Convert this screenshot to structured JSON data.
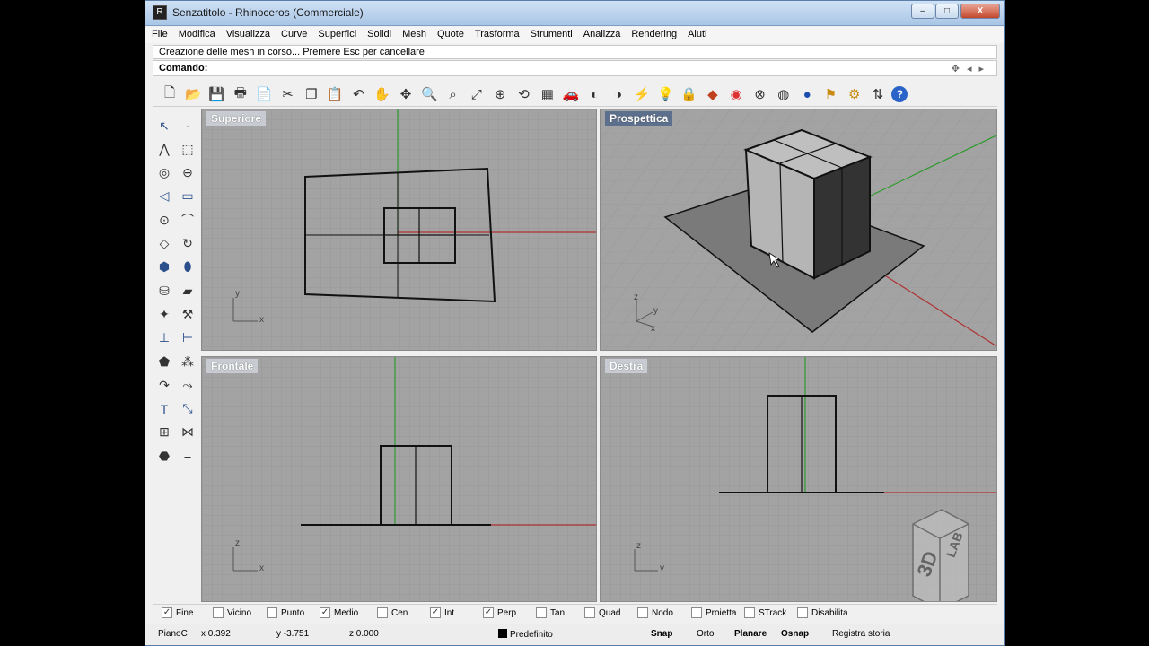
{
  "window": {
    "title": "Senzatitolo - Rhinoceros (Commerciale)",
    "controls": {
      "minimize": "–",
      "maximize": "□",
      "close": "X"
    }
  },
  "menu": [
    "File",
    "Modifica",
    "Visualizza",
    "Curve",
    "Superfici",
    "Solidi",
    "Mesh",
    "Quote",
    "Trasforma",
    "Strumenti",
    "Analizza",
    "Rendering",
    "Aiuti"
  ],
  "command": {
    "history": "Creazione delle mesh in corso... Premere Esc per cancellare",
    "prompt": "Comando:"
  },
  "toolbar_icons": [
    "new-icon",
    "open-icon",
    "save-icon",
    "print-icon",
    "import-icon",
    "cut-icon",
    "copy-icon",
    "paste-icon",
    "undo-icon",
    "pan-hand-icon",
    "move-view-icon",
    "zoom-icon",
    "zoom-window-icon",
    "zoom-extents-icon",
    "zoom-selected-icon",
    "rotate-view-icon",
    "four-viewports-icon",
    "car-icon",
    "hide-icon",
    "show-icon",
    "snap-icon",
    "light-icon",
    "lock-icon",
    "layer-icon",
    "color-wheel-icon",
    "sphere-wire-icon",
    "sphere-shaded-icon",
    "sphere-render-icon",
    "flag-icon",
    "gear-icon",
    "options-icon",
    "help-icon"
  ],
  "viewports": {
    "top": {
      "label": "Superiore",
      "axes": [
        "y",
        "x"
      ]
    },
    "perspective": {
      "label": "Prospettica",
      "axes": [
        "z",
        "y",
        "x"
      ]
    },
    "front": {
      "label": "Frontale",
      "axes": [
        "z",
        "x"
      ]
    },
    "right": {
      "label": "Destra",
      "axes": [
        "z",
        "y"
      ]
    }
  },
  "osnaps": [
    {
      "label": "Fine",
      "checked": true
    },
    {
      "label": "Vicino",
      "checked": false
    },
    {
      "label": "Punto",
      "checked": false
    },
    {
      "label": "Medio",
      "checked": true
    },
    {
      "label": "Cen",
      "checked": false
    },
    {
      "label": "Int",
      "checked": true
    },
    {
      "label": "Perp",
      "checked": true
    },
    {
      "label": "Tan",
      "checked": false
    },
    {
      "label": "Quad",
      "checked": false
    },
    {
      "label": "Nodo",
      "checked": false
    },
    {
      "label": "Proietta",
      "checked": false
    },
    {
      "label": "STrack",
      "checked": false
    },
    {
      "label": "Disabilita",
      "checked": false
    }
  ],
  "status": {
    "cplane": "PianoC",
    "x": "x 0.392",
    "y": "y -3.751",
    "z": "z 0.000",
    "layer": "Predefinito",
    "snap": "Snap",
    "ortho": "Orto",
    "planar": "Planare",
    "osnap": "Osnap",
    "history": "Registra storia"
  },
  "colors": {
    "viewport_bg": "#a3a3a3",
    "x_axis": "#b03030",
    "y_axis": "#2e9a2e",
    "active_label": "#5c6f8c"
  }
}
